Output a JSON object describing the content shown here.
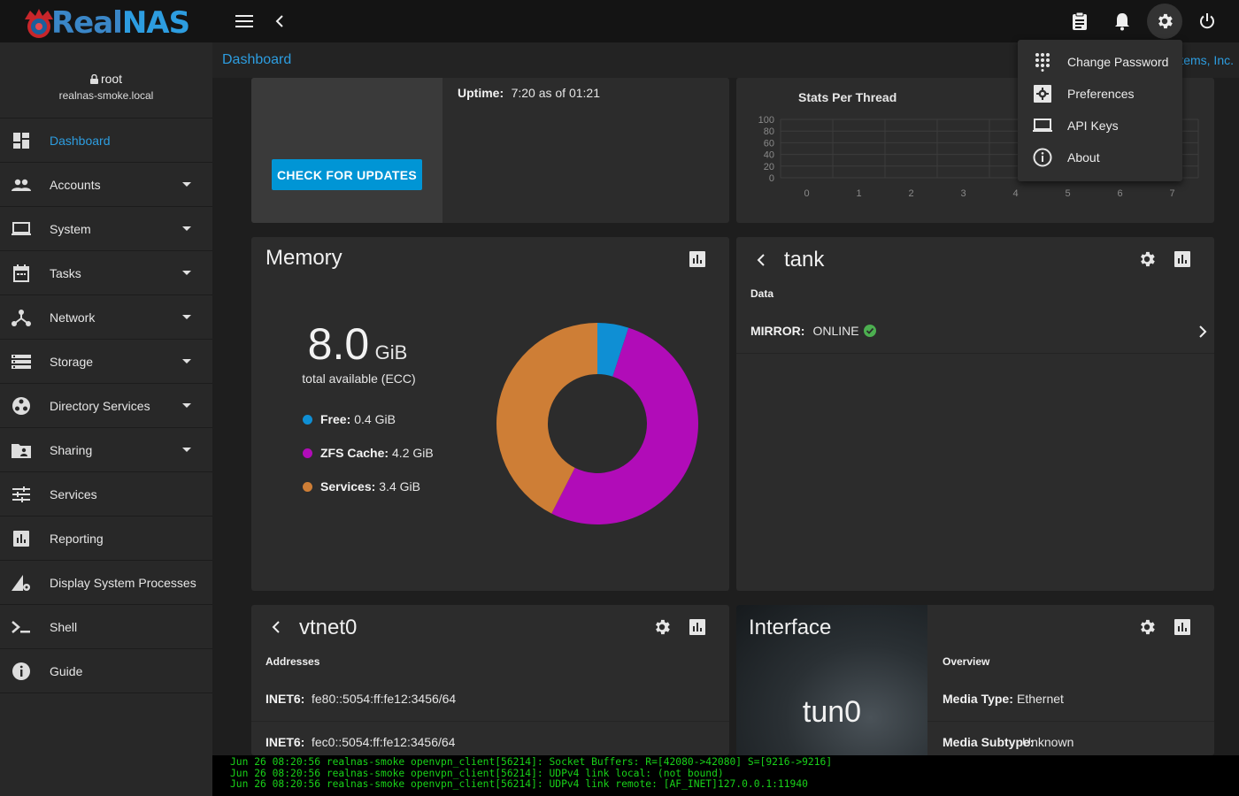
{
  "app": {
    "logo_text_a": "Real",
    "logo_text_b": "NAS"
  },
  "user": {
    "name": "root",
    "host": "realnas-smoke.local"
  },
  "sidebar": {
    "items": [
      {
        "label": "Dashboard",
        "icon": "dashboard-icon",
        "active": true,
        "expandable": false
      },
      {
        "label": "Accounts",
        "icon": "people-icon",
        "expandable": true
      },
      {
        "label": "System",
        "icon": "laptop-icon",
        "expandable": true
      },
      {
        "label": "Tasks",
        "icon": "calendar-icon",
        "expandable": true
      },
      {
        "label": "Network",
        "icon": "network-icon",
        "expandable": true
      },
      {
        "label": "Storage",
        "icon": "storage-icon",
        "expandable": true
      },
      {
        "label": "Directory Services",
        "icon": "directory-icon",
        "expandable": true
      },
      {
        "label": "Sharing",
        "icon": "folder-share-icon",
        "expandable": true
      },
      {
        "label": "Services",
        "icon": "tune-icon",
        "expandable": false
      },
      {
        "label": "Reporting",
        "icon": "chart-icon",
        "expandable": false
      },
      {
        "label": "Display System Processes",
        "icon": "processes-icon",
        "expandable": false
      },
      {
        "label": "Shell",
        "icon": "terminal-icon",
        "expandable": false
      },
      {
        "label": "Guide",
        "icon": "info-icon",
        "expandable": false
      }
    ]
  },
  "breadcrumb": {
    "current": "Dashboard",
    "right_text": "tems, Inc."
  },
  "sysinfo": {
    "uptime_label": "Uptime:",
    "uptime_value": "7:20 as of 01:21",
    "update_button": "CHECK FOR UPDATES"
  },
  "cpu": {
    "subtitle": "Stats Per Thread"
  },
  "memory": {
    "title": "Memory",
    "total": "8.0",
    "unit": "GiB",
    "total_caption": "total available (ECC)",
    "legend": [
      {
        "label": "Free:",
        "value": "0.4 GiB",
        "color": "#0f8fd4"
      },
      {
        "label": "ZFS Cache:",
        "value": "4.2 GiB",
        "color": "#b10cb8"
      },
      {
        "label": "Services:",
        "value": "3.4 GiB",
        "color": "#ce7e36"
      }
    ]
  },
  "pool": {
    "title": "tank",
    "section": "Data",
    "row_label": "MIRROR:",
    "row_value": "ONLINE",
    "status_color": "#4caf50"
  },
  "nic": {
    "title": "vtnet0",
    "section": "Addresses",
    "rows": [
      {
        "label": "INET6:",
        "value": "fe80::5054:ff:fe12:3456/64"
      },
      {
        "label": "INET6:",
        "value": "fec0::5054:ff:fe12:3456/64"
      }
    ]
  },
  "iface": {
    "title": "Interface",
    "name": "tun0",
    "section": "Overview",
    "rows": [
      {
        "label": "Media Type:",
        "value": "Ethernet"
      },
      {
        "label": "Media Subtype:",
        "value": "Unknown"
      }
    ]
  },
  "settings_menu": {
    "items": [
      {
        "label": "Change Password",
        "icon": "dialpad-icon"
      },
      {
        "label": "Preferences",
        "icon": "preferences-icon"
      },
      {
        "label": "API Keys",
        "icon": "laptop-icon"
      },
      {
        "label": "About",
        "icon": "info-icon"
      }
    ]
  },
  "console": {
    "lines": [
      "Jun 26 08:20:56 realnas-smoke openvpn_client[56214]: Socket Buffers: R=[42080->42080] S=[9216->9216]",
      "Jun 26 08:20:56 realnas-smoke openvpn_client[56214]: UDPv4 link local: (not bound)",
      "Jun 26 08:20:56 realnas-smoke openvpn_client[56214]: UDPv4 link remote: [AF_INET]127.0.0.1:11940"
    ]
  },
  "chart_data": [
    {
      "type": "line",
      "title": "Stats Per Thread",
      "categories": [
        "0",
        "1",
        "2",
        "3",
        "4",
        "5",
        "6",
        "7"
      ],
      "yticks": [
        "100",
        "80",
        "60",
        "40",
        "20",
        "0"
      ],
      "ylim": [
        0,
        100
      ],
      "series": [],
      "grid": true
    },
    {
      "type": "pie",
      "title": "Memory",
      "categories": [
        "Free",
        "ZFS Cache",
        "Services"
      ],
      "values": [
        0.4,
        4.2,
        3.4
      ],
      "colors": [
        "#0f8fd4",
        "#b10cb8",
        "#ce7e36"
      ],
      "donut": true
    }
  ]
}
